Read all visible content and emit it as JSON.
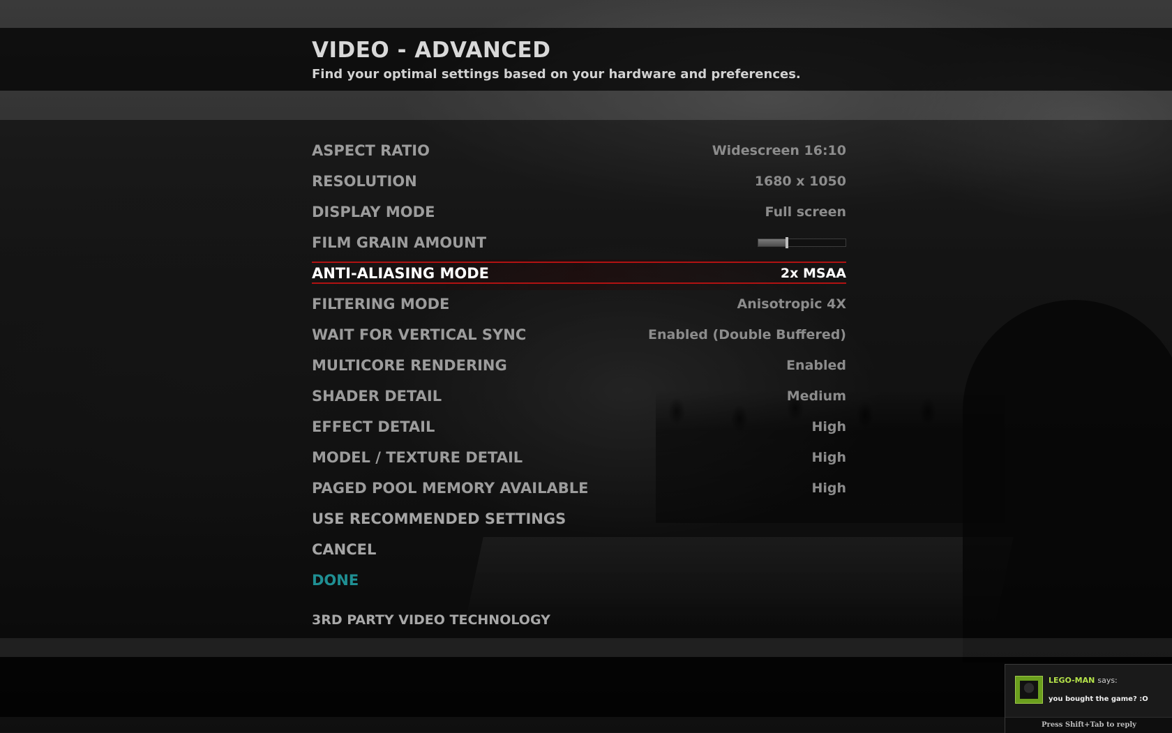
{
  "header": {
    "title": "VIDEO - ADVANCED",
    "subtitle": "Find your optimal settings based on your hardware and preferences."
  },
  "settings": [
    {
      "label": "ASPECT RATIO",
      "value": "Widescreen 16:10"
    },
    {
      "label": "RESOLUTION",
      "value": "1680 x 1050"
    },
    {
      "label": "DISPLAY MODE",
      "value": "Full screen"
    },
    {
      "label": "FILM GRAIN AMOUNT",
      "slider_fraction": 0.33
    },
    {
      "label": "ANTI-ALIASING MODE",
      "value": "2x MSAA",
      "selected": true
    },
    {
      "label": "FILTERING MODE",
      "value": "Anisotropic 4X"
    },
    {
      "label": "WAIT FOR VERTICAL SYNC",
      "value": "Enabled (Double Buffered)"
    },
    {
      "label": "MULTICORE RENDERING",
      "value": "Enabled"
    },
    {
      "label": "SHADER DETAIL",
      "value": "Medium"
    },
    {
      "label": "EFFECT DETAIL",
      "value": "High"
    },
    {
      "label": "MODEL / TEXTURE DETAIL",
      "value": "High"
    },
    {
      "label": "PAGED POOL MEMORY AVAILABLE",
      "value": "High"
    }
  ],
  "actions": {
    "recommended": "USE RECOMMENDED SETTINGS",
    "cancel": "CANCEL",
    "done": "DONE",
    "third_party": "3RD PARTY VIDEO TECHNOLOGY"
  },
  "chat": {
    "name": "LEGO-MAN",
    "says": "says:",
    "message": "you bought the game? :O",
    "hint": "Press Shift+Tab to reply"
  },
  "colors": {
    "selection_red": "#b11212",
    "done_teal": "#1f8f93",
    "chat_name_green": "#b5e34a"
  }
}
